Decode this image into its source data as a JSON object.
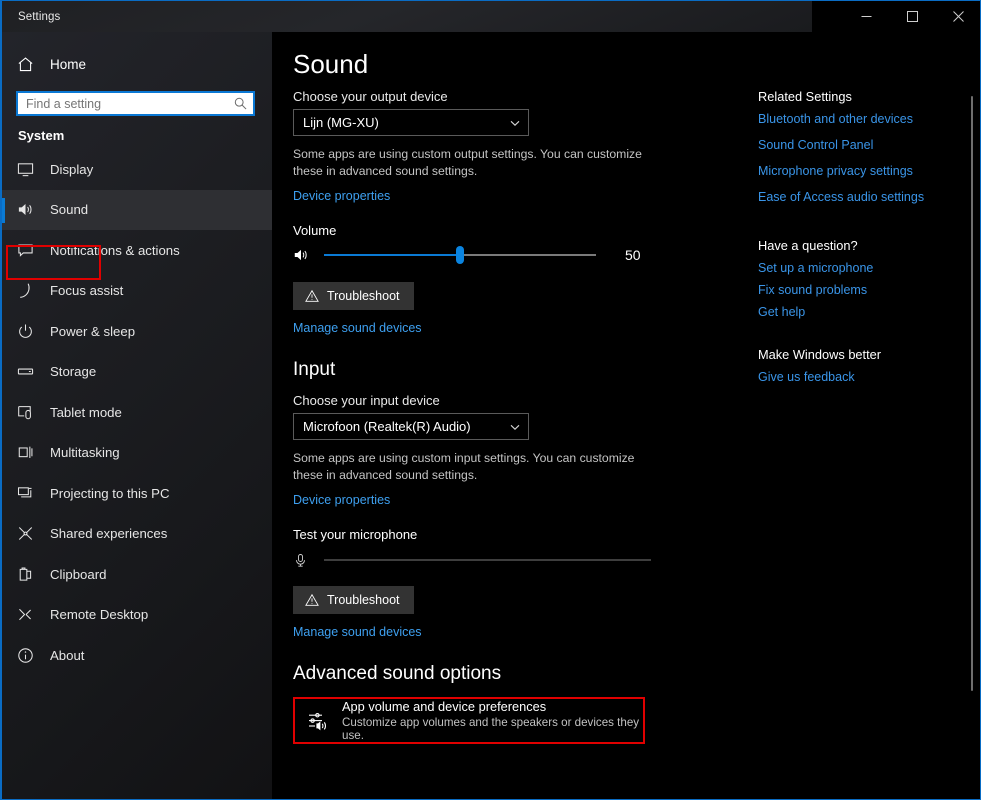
{
  "window": {
    "title": "Settings",
    "controls": {
      "minimize": "minimize-button",
      "maximize": "maximize-button",
      "close": "close-button"
    },
    "accent_color": "#0a7ad4",
    "highlight_color": "#e00000"
  },
  "sidebar": {
    "home_label": "Home",
    "search": {
      "placeholder": "Find a setting",
      "value": ""
    },
    "group_title": "System",
    "items": [
      {
        "label": "Display",
        "icon": "monitor-icon",
        "selected": false
      },
      {
        "label": "Sound",
        "icon": "speaker-icon",
        "selected": true
      },
      {
        "label": "Notifications & actions",
        "icon": "notification-icon",
        "selected": false
      },
      {
        "label": "Focus assist",
        "icon": "moon-icon",
        "selected": false
      },
      {
        "label": "Power & sleep",
        "icon": "power-icon",
        "selected": false
      },
      {
        "label": "Storage",
        "icon": "storage-icon",
        "selected": false
      },
      {
        "label": "Tablet mode",
        "icon": "tablet-icon",
        "selected": false
      },
      {
        "label": "Multitasking",
        "icon": "multitasking-icon",
        "selected": false
      },
      {
        "label": "Projecting to this PC",
        "icon": "projecting-icon",
        "selected": false
      },
      {
        "label": "Shared experiences",
        "icon": "shared-icon",
        "selected": false
      },
      {
        "label": "Clipboard",
        "icon": "clipboard-icon",
        "selected": false
      },
      {
        "label": "Remote Desktop",
        "icon": "remote-desktop-icon",
        "selected": false
      },
      {
        "label": "About",
        "icon": "info-icon",
        "selected": false
      }
    ]
  },
  "main": {
    "page_title": "Sound",
    "output": {
      "device_label": "Choose your output device",
      "device_value": "Lijn (MG-XU)",
      "helper_text": "Some apps are using custom output settings. You can customize these in advanced sound settings.",
      "device_properties_link": "Device properties",
      "volume_label": "Volume",
      "volume_value": "50",
      "volume_percent": 50,
      "troubleshoot_label": "Troubleshoot",
      "manage_link": "Manage sound devices"
    },
    "input": {
      "section_title": "Input",
      "device_label": "Choose your input device",
      "device_value": "Microfoon (Realtek(R) Audio)",
      "helper_text": "Some apps are using custom input settings. You can customize these in advanced sound settings.",
      "device_properties_link": "Device properties",
      "test_label": "Test your microphone",
      "test_level_percent": 0,
      "troubleshoot_label": "Troubleshoot",
      "manage_link": "Manage sound devices"
    },
    "advanced": {
      "section_title": "Advanced sound options",
      "card_title": "App volume and device preferences",
      "card_subtitle": "Customize app volumes and the speakers or devices they use."
    }
  },
  "right_rail": {
    "related_head": "Related Settings",
    "related_links": [
      "Bluetooth and other devices",
      "Sound Control Panel",
      "Microphone privacy settings",
      "Ease of Access audio settings"
    ],
    "question_head": "Have a question?",
    "question_links": [
      "Set up a microphone",
      "Fix sound problems",
      "Get help"
    ],
    "feedback_head": "Make Windows better",
    "feedback_links": [
      "Give us feedback"
    ]
  }
}
